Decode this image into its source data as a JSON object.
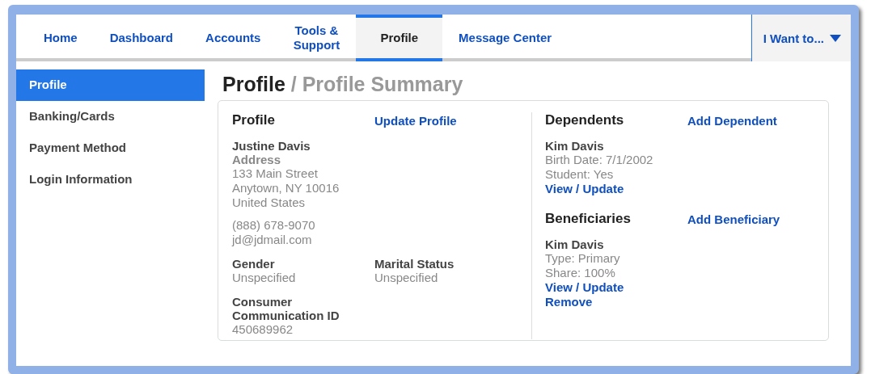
{
  "nav": {
    "tabs": [
      {
        "label": "Home",
        "selected": false
      },
      {
        "label": "Dashboard",
        "selected": false
      },
      {
        "label": "Accounts",
        "selected": false
      },
      {
        "label": "Tools & Support",
        "selected": false
      },
      {
        "label": "Profile",
        "selected": true
      },
      {
        "label": "Message Center",
        "selected": false
      }
    ],
    "menu": {
      "label": "I Want to..."
    }
  },
  "sidebar": {
    "items": [
      {
        "label": "Profile",
        "selected": true
      },
      {
        "label": "Banking/Cards",
        "selected": false
      },
      {
        "label": "Payment Method",
        "selected": false
      },
      {
        "label": "Login Information",
        "selected": false
      }
    ]
  },
  "page_title": {
    "title": "Profile",
    "subtitle": "/ Profile Summary"
  },
  "profile": {
    "heading": "Profile",
    "action": "Update Profile",
    "name": "Justine Davis",
    "address_label": "Address",
    "address_lines": [
      "133 Main Street",
      "Anytown, NY 10016",
      "United States"
    ],
    "contact_lines": [
      "(888) 678-9070",
      "jd@jdmail.com"
    ],
    "fields": [
      {
        "label": "Gender",
        "value": "Unspecified"
      },
      {
        "label": "Marital Status",
        "value": "Unspecified"
      },
      {
        "label": "Consumer Communication ID",
        "value": "450689962"
      }
    ]
  },
  "sections": [
    {
      "heading": "Dependents",
      "action": "Add Dependent",
      "items": [
        {
          "name": "Kim Davis",
          "lines": [
            "Birth Date: 7/1/2002",
            "Student: Yes"
          ],
          "links": [
            "View / Update"
          ]
        }
      ]
    },
    {
      "heading": "Beneficiaries",
      "action": "Add Beneficiary",
      "items": [
        {
          "name": "Kim Davis",
          "lines": [
            "Type: Primary",
            "Share: 100%"
          ],
          "links": [
            "View / Update",
            "Remove"
          ]
        }
      ]
    }
  ]
}
